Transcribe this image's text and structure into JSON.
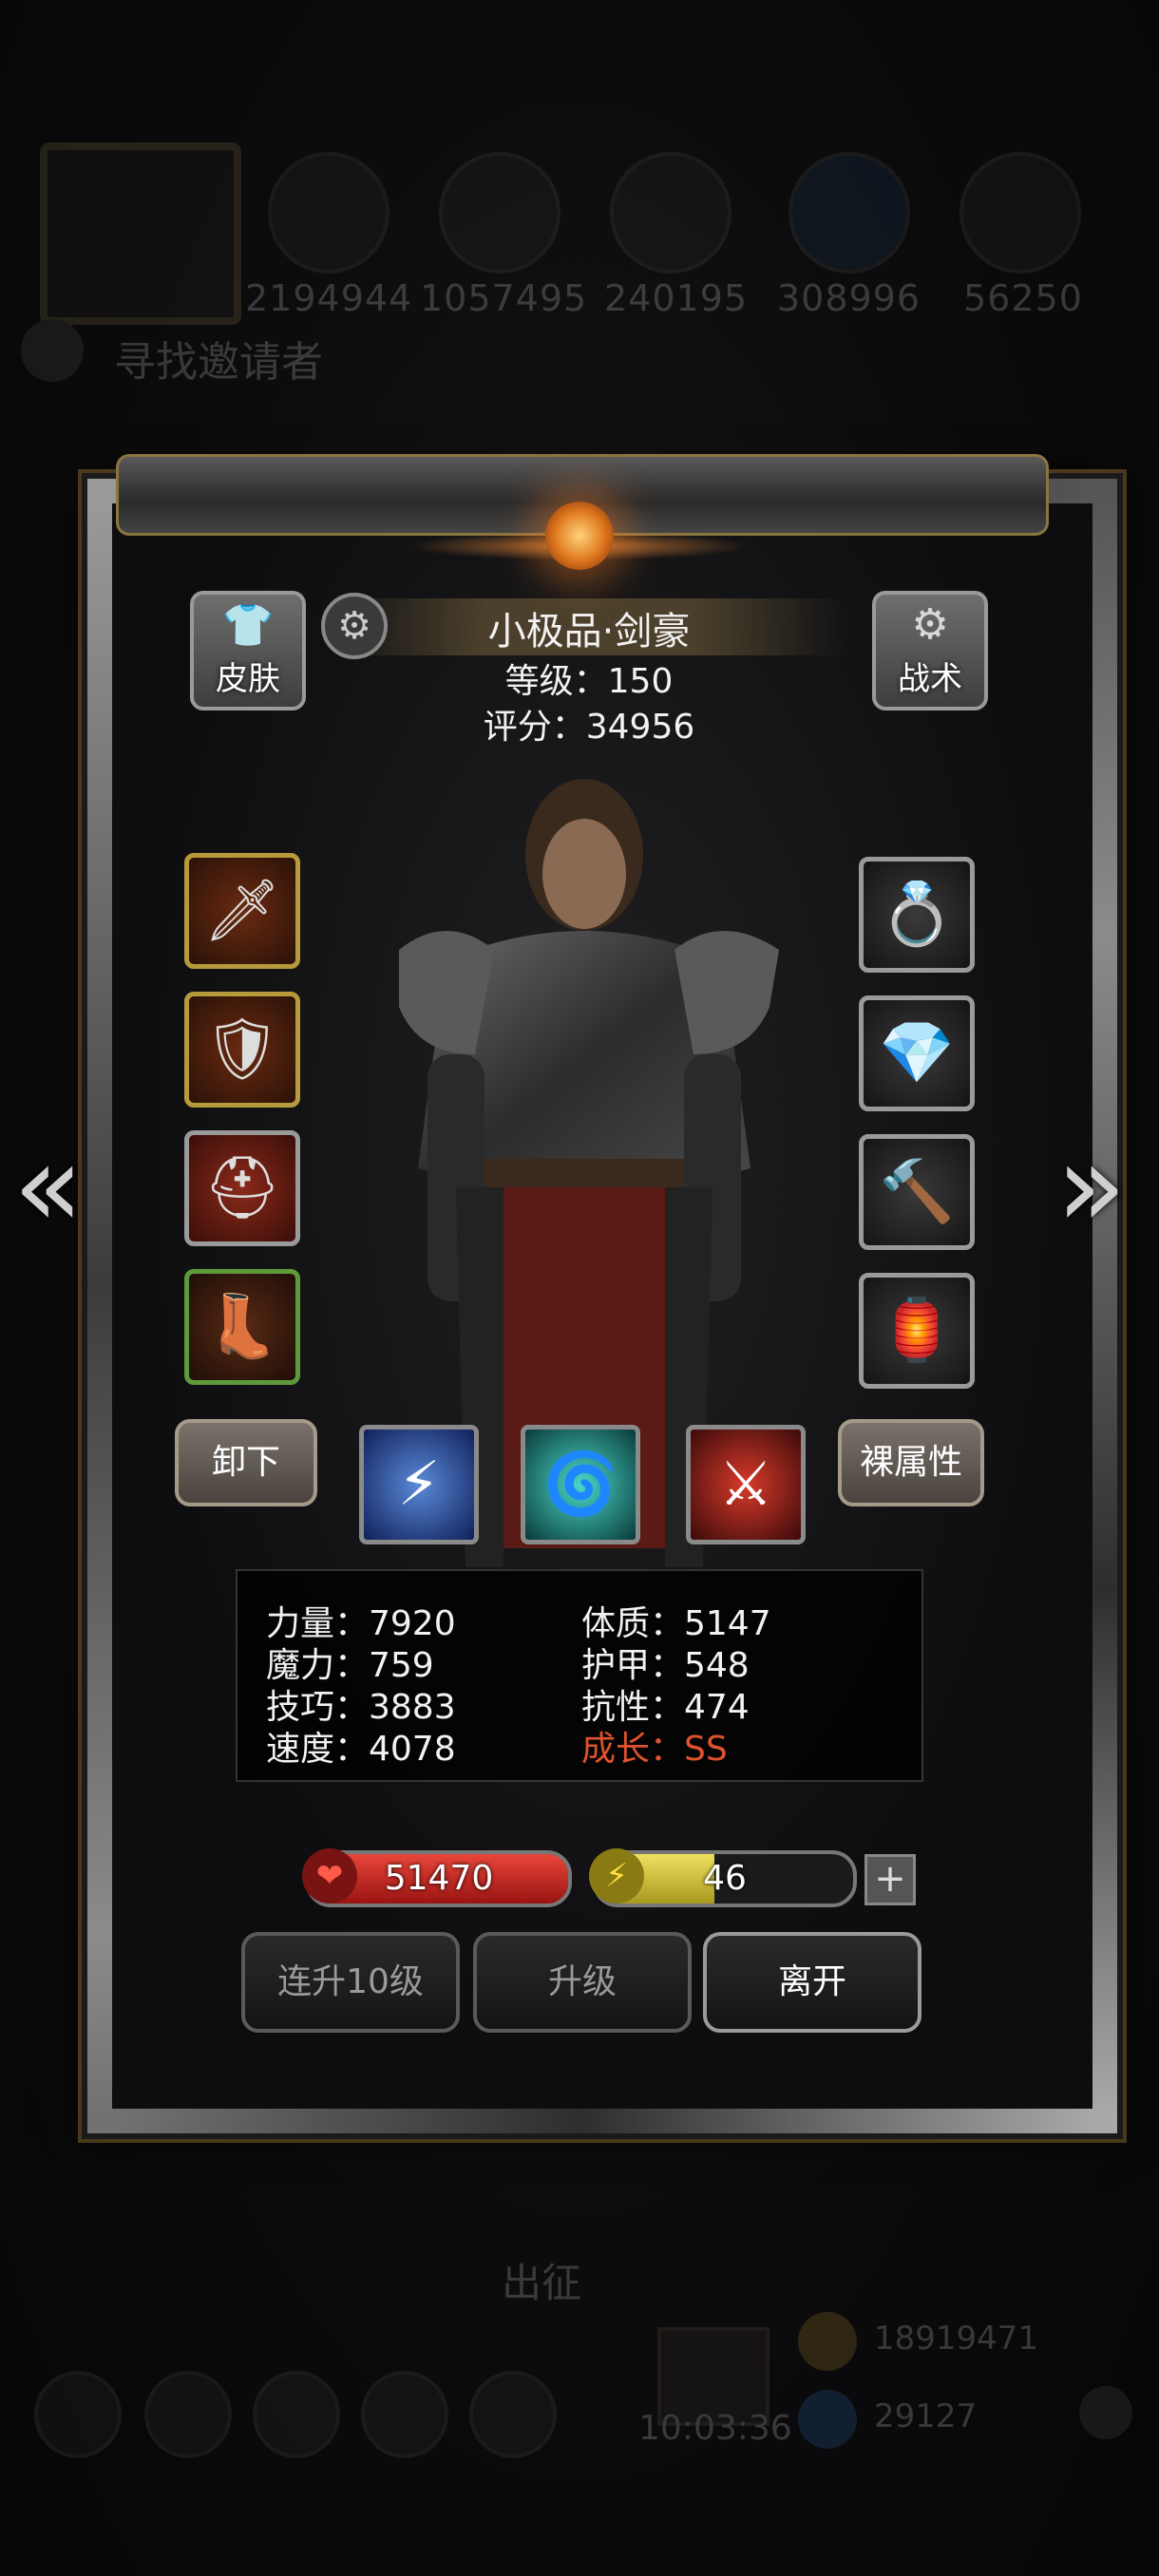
{
  "background": {
    "resources": [
      "2194944",
      "1057495",
      "240195",
      "308996",
      "56250"
    ],
    "invite_text": "寻找邀请者",
    "depart_text": "出征",
    "timer": "10:03:36",
    "gold": "18919471",
    "gems": "29127"
  },
  "hero": {
    "name": "小极品·剑豪",
    "level": "等级：150",
    "score": "评分：34956"
  },
  "buttons": {
    "skin": "皮肤",
    "tactics": "战术",
    "unequip": "卸下",
    "naked_attr": "裸属性",
    "level_up_10": "连升10级",
    "level_up": "升级",
    "leave": "离开"
  },
  "stats": {
    "strength": "力量：7920",
    "physique": "体质：5147",
    "magic": "魔力：759",
    "armor": "护甲：548",
    "skill": "技巧：3883",
    "resistance": "抗性：474",
    "speed": "速度：4078",
    "growth": "成长：SS"
  },
  "bars": {
    "hp": "51470",
    "hp_fill": 1.0,
    "energy": "46",
    "energy_fill": 0.46
  },
  "colors": {
    "accent_gold": "#b79a3c",
    "hp_red": "#c8201e",
    "energy_yellow": "#d8c43a",
    "growth_red": "#e0522e"
  },
  "icons": {
    "left_arrow": "double-chevron-left-icon",
    "right_arrow": "double-chevron-right-icon"
  }
}
